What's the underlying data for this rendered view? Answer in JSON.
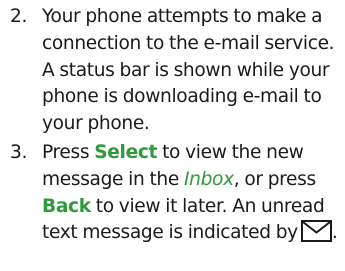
{
  "steps": [
    {
      "number": "2.",
      "lines": [
        "Your phone attempts to make a",
        "connection to the e-mail service.",
        "A status bar is shown while your",
        "phone is downloading e-mail to",
        "your phone."
      ]
    },
    {
      "number": "3.",
      "line1_pre": "Press ",
      "key_select": "Select",
      "line1_post": " to view the new",
      "line2_pre": "message in the ",
      "folder_inbox": "Inbox",
      "line2_post": ", or press",
      "key_back": "Back",
      "line3_post": " to view it later. An unread",
      "line4": "text message is indicated by",
      "line4_end": "."
    }
  ],
  "icons": {
    "unread_message": "envelope-icon"
  },
  "colors": {
    "keyword": "#2e9a3a",
    "text": "#1a1a1a"
  }
}
